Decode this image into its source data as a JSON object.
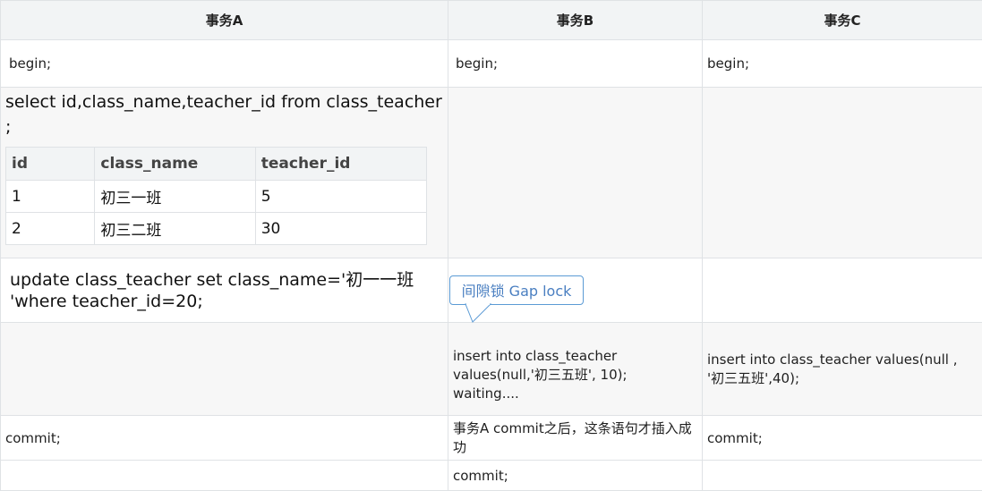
{
  "headers": [
    "事务A",
    "事务B",
    "事务C"
  ],
  "rows": {
    "begin": {
      "a": "begin;",
      "b": "begin;",
      "c": "begin;"
    },
    "select": {
      "sql": "select id,class_name,teacher_id from class_teacher ;",
      "result": {
        "columns": [
          "id",
          "class_name",
          "teacher_id"
        ],
        "rows": [
          [
            "1",
            "初三一班",
            "5"
          ],
          [
            "2",
            "初三二班",
            "30"
          ]
        ]
      }
    },
    "update": {
      "a": "update class_teacher set class_name='初一一班 'where teacher_id=20;"
    },
    "insert": {
      "b": "insert into class_teacher values(null,'初三五班', 10); waiting....",
      "c": "insert into class_teacher values(null , '初三五班',40);"
    },
    "commit": {
      "a": "commit;",
      "b": "事务A commit之后，这条语句才插入成功",
      "c": "commit;"
    },
    "final": {
      "b": "commit;"
    }
  },
  "callout": {
    "text": "间隙锁 Gap lock",
    "border_color": "#5b9bd5"
  }
}
